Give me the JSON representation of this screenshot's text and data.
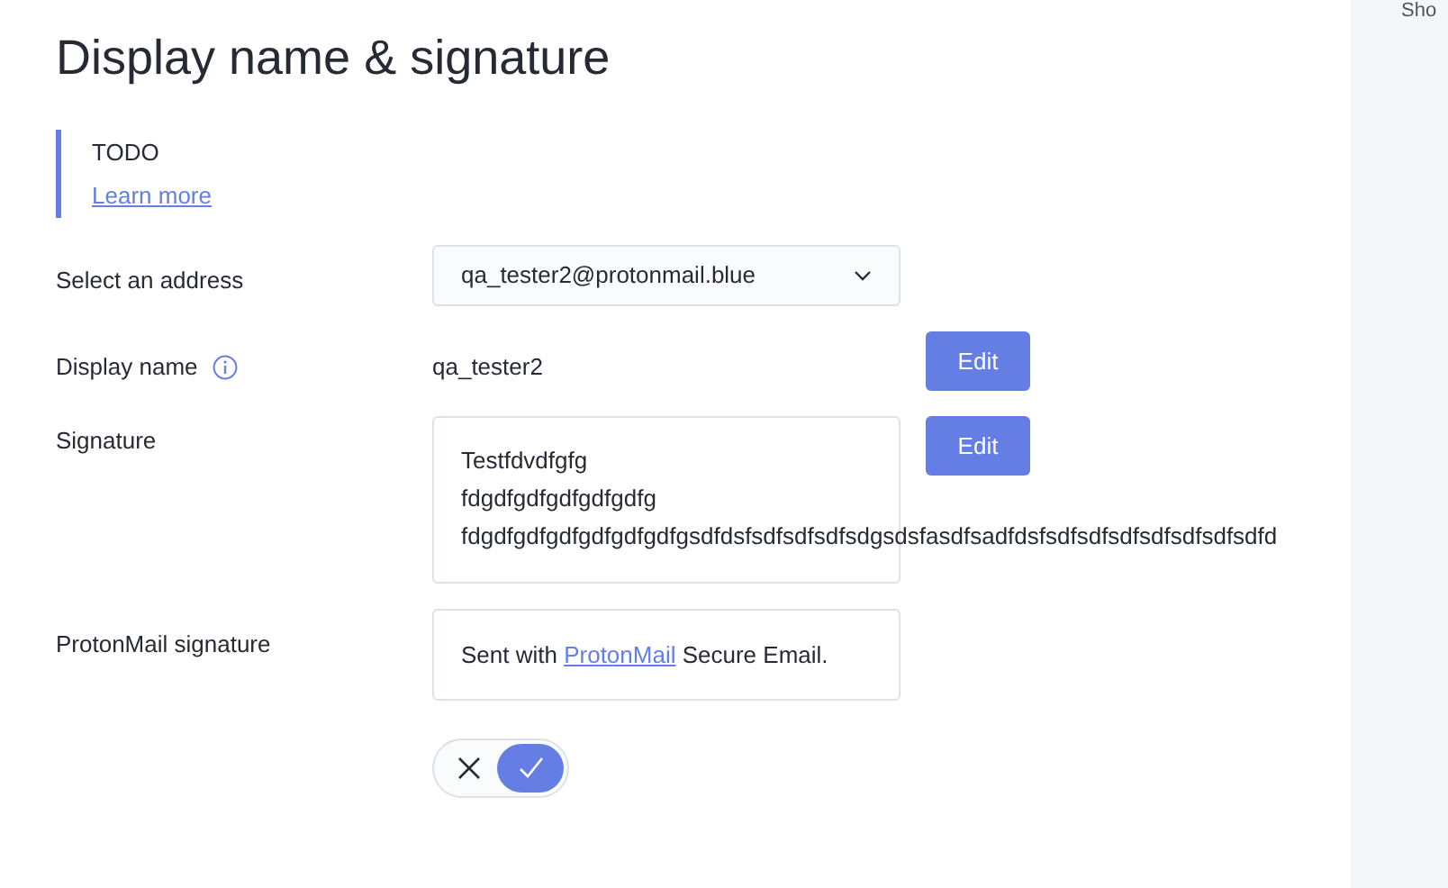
{
  "title": "Display name & signature",
  "notice": {
    "text": "TODO",
    "link": "Learn more"
  },
  "side_panel": {
    "text": "Sho"
  },
  "address": {
    "label": "Select an address",
    "value": "qa_tester2@protonmail.blue"
  },
  "display_name": {
    "label": "Display name",
    "value": "qa_tester2",
    "button": "Edit"
  },
  "signature": {
    "label": "Signature",
    "lines": [
      "Testfdvdfgfg",
      "fdgdfgdfgdfgdfgdfg",
      "fdgdfgdfgdfgdfgdfgdfgsdfdsfsdfsdfsdfsdgsdsfasdfsadfdsfsdfsdfsdfsdfsdfsdfsdfd"
    ],
    "button": "Edit"
  },
  "proton_signature": {
    "label": "ProtonMail signature",
    "before": "Sent with ",
    "link": "ProtonMail",
    "after": " Secure Email.",
    "on": true
  }
}
